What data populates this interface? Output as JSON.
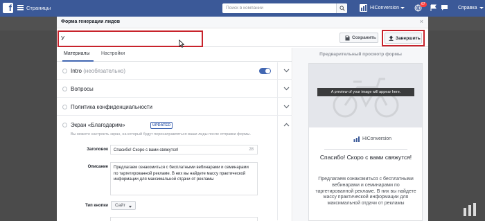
{
  "topbar": {
    "logo": "f",
    "pages_label": "Страницы",
    "search_placeholder": "Поиск в компании",
    "user_name": "HiConversion",
    "notifications_count": "67",
    "help_label": "Справка"
  },
  "modal": {
    "title": "Форма генерации лидов",
    "close": "×",
    "form_name_value": "У",
    "save_label": "Сохранить",
    "finish_label": "Завершить"
  },
  "tabs": [
    {
      "label": "Материалы",
      "active": true
    },
    {
      "label": "Настройки",
      "active": false
    }
  ],
  "sections": {
    "intro": {
      "title": "Intro",
      "subtitle": "(необязательно)",
      "toggle_on": true
    },
    "questions": {
      "title": "Вопросы"
    },
    "privacy": {
      "title": "Политика конфиденциальности"
    },
    "thankyou": {
      "title": "Экран «Благодарим»",
      "badge": "UPDATED",
      "hint": "Вы можете настроить экран, на который будут перенаправляться ваши лиды после отправки формы.",
      "headline_label": "Заголовок",
      "headline_value": "Спасибо! Скоро с вами свяжутся!",
      "headline_counter": "28",
      "description_label": "Описание",
      "description_value": "Предлагаем ознакомиться с бесплатными вебинарами и семинарами по таргетированной рекламе. В них вы найдете массу практической информации для максимальной отдачи от рекламы",
      "button_type_label": "Тип кнопки",
      "button_type_value": "Сайт"
    }
  },
  "preview": {
    "title": "Предварительный просмотр формы",
    "image_banner": "A preview of your image will appear here.",
    "brand_name": "HiConversion",
    "headline": "Спасибо! Скоро с вами свяжутся!",
    "body": "Предлагаем ознакомиться с бесплатными вебинарами и семинарами по таргетированной рекламе. В них вы найдете массу практической информации для максимальной отдачи от рекламы"
  },
  "colors": {
    "facebook_blue": "#3b5998",
    "highlight_red": "#c8232c",
    "toggle_blue": "#4267b2"
  }
}
